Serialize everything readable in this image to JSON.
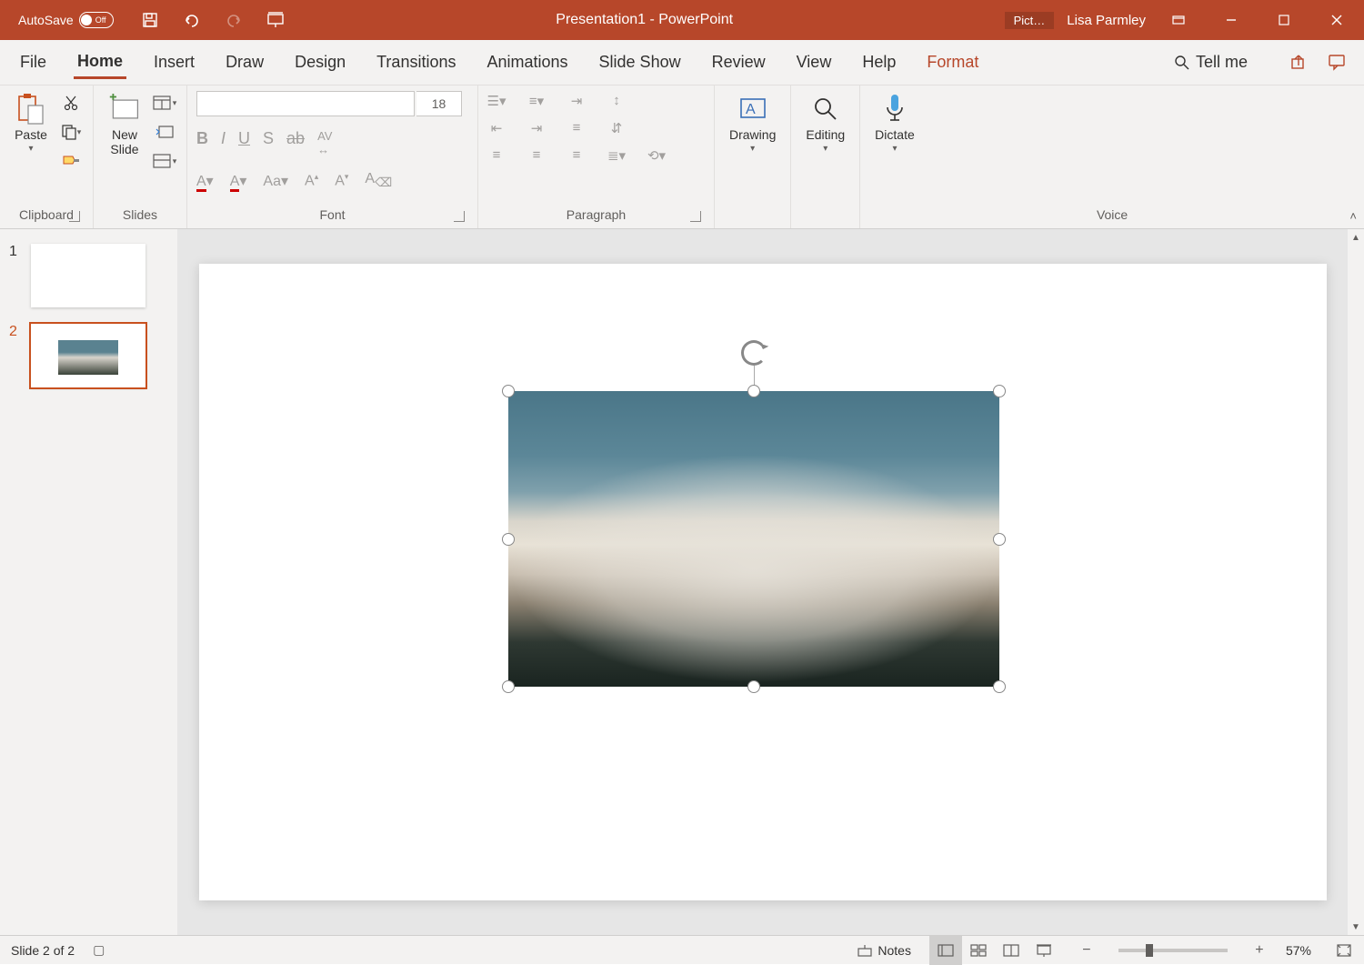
{
  "titlebar": {
    "autosave_label": "AutoSave",
    "autosave_state": "Off",
    "doc_title": "Presentation1  -  PowerPoint",
    "context_badge": "Pict…",
    "user": "Lisa Parmley"
  },
  "tabs": {
    "file": "File",
    "home": "Home",
    "insert": "Insert",
    "draw": "Draw",
    "design": "Design",
    "transitions": "Transitions",
    "animations": "Animations",
    "slideshow": "Slide Show",
    "review": "Review",
    "view": "View",
    "help": "Help",
    "format": "Format",
    "tellme": "Tell me"
  },
  "ribbon": {
    "clipboard": {
      "label": "Clipboard",
      "paste": "Paste"
    },
    "slides": {
      "label": "Slides",
      "newslide": "New\nSlide"
    },
    "font": {
      "label": "Font",
      "size": "18"
    },
    "paragraph": {
      "label": "Paragraph"
    },
    "drawing": {
      "label": "Drawing"
    },
    "editing": {
      "label": "Editing"
    },
    "voice": {
      "label": "Voice",
      "dictate": "Dictate"
    }
  },
  "thumbs": [
    {
      "num": "1",
      "selected": false,
      "hasImage": false
    },
    {
      "num": "2",
      "selected": true,
      "hasImage": true
    }
  ],
  "status": {
    "slide_info": "Slide 2 of 2",
    "notes": "Notes",
    "zoom": "57%"
  }
}
